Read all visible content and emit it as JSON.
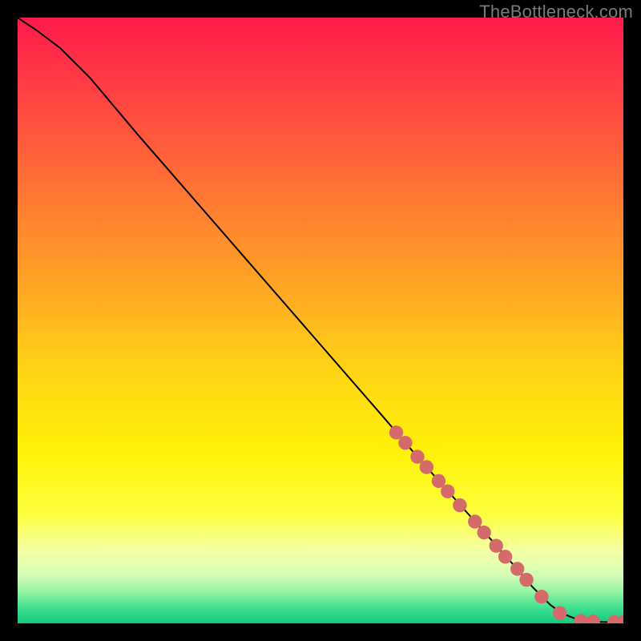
{
  "watermark": "TheBottleneck.com",
  "chart_data": {
    "type": "line",
    "title": "",
    "xlabel": "",
    "ylabel": "",
    "xlim": [
      0,
      100
    ],
    "ylim": [
      0,
      100
    ],
    "grid": false,
    "legend": false,
    "gradient_stops": [
      {
        "offset": 0.0,
        "color": "#ff1a4b"
      },
      {
        "offset": 0.12,
        "color": "#ff3f43"
      },
      {
        "offset": 0.28,
        "color": "#ff7234"
      },
      {
        "offset": 0.44,
        "color": "#ffa524"
      },
      {
        "offset": 0.58,
        "color": "#ffd315"
      },
      {
        "offset": 0.72,
        "color": "#fff208"
      },
      {
        "offset": 0.82,
        "color": "#fcff3e"
      },
      {
        "offset": 0.88,
        "color": "#f5ffa5"
      },
      {
        "offset": 0.92,
        "color": "#d5fdb7"
      },
      {
        "offset": 0.95,
        "color": "#8ef2a0"
      },
      {
        "offset": 0.975,
        "color": "#3de08f"
      },
      {
        "offset": 1.0,
        "color": "#17c77f"
      }
    ],
    "series": [
      {
        "name": "curve",
        "x": [
          0,
          3,
          7,
          12,
          20,
          30,
          40,
          50,
          60,
          66,
          70,
          74,
          78,
          82,
          85,
          88,
          90,
          92,
          94,
          96,
          98,
          100
        ],
        "y": [
          100,
          98,
          95,
          90,
          80.5,
          69,
          57.5,
          46,
          34.5,
          27.5,
          23,
          18.5,
          14,
          9.5,
          6,
          3,
          1.6,
          0.8,
          0.4,
          0.25,
          0.2,
          0.2
        ]
      }
    ],
    "markers": {
      "color": "#d46a6a",
      "radius_pct": 1.15,
      "points": [
        {
          "x": 62.5,
          "y": 31.5
        },
        {
          "x": 64.0,
          "y": 29.8
        },
        {
          "x": 66.0,
          "y": 27.5
        },
        {
          "x": 67.5,
          "y": 25.8
        },
        {
          "x": 69.5,
          "y": 23.5
        },
        {
          "x": 71.0,
          "y": 21.8
        },
        {
          "x": 73.0,
          "y": 19.5
        },
        {
          "x": 75.5,
          "y": 16.8
        },
        {
          "x": 77.0,
          "y": 15.0
        },
        {
          "x": 79.0,
          "y": 12.8
        },
        {
          "x": 80.5,
          "y": 11.0
        },
        {
          "x": 82.5,
          "y": 9.0
        },
        {
          "x": 84.0,
          "y": 7.2
        },
        {
          "x": 86.5,
          "y": 4.4
        },
        {
          "x": 89.5,
          "y": 1.7
        },
        {
          "x": 93.0,
          "y": 0.4
        },
        {
          "x": 95.0,
          "y": 0.3
        },
        {
          "x": 98.5,
          "y": 0.2
        },
        {
          "x": 100.0,
          "y": 0.2
        }
      ]
    }
  }
}
